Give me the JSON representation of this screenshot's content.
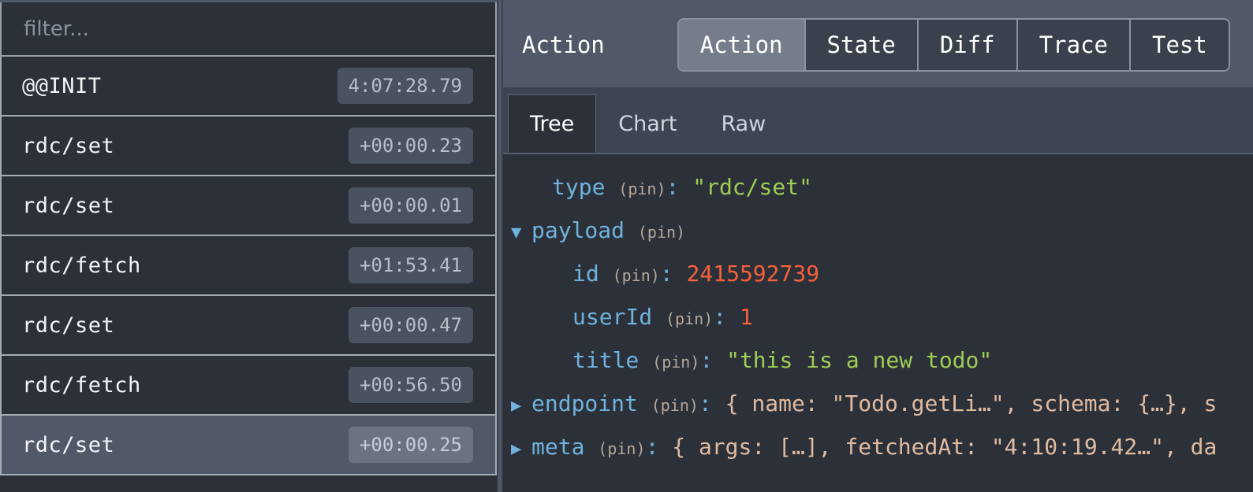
{
  "left_panel": {
    "filter": {
      "placeholder": "filter...",
      "value": ""
    },
    "actions": [
      {
        "name": "@@INIT",
        "time": "4:07:28.79",
        "selected": false
      },
      {
        "name": "rdc/set",
        "time": "+00:00.23",
        "selected": false
      },
      {
        "name": "rdc/set",
        "time": "+00:00.01",
        "selected": false
      },
      {
        "name": "rdc/fetch",
        "time": "+01:53.41",
        "selected": false
      },
      {
        "name": "rdc/set",
        "time": "+00:00.47",
        "selected": false
      },
      {
        "name": "rdc/fetch",
        "time": "+00:56.50",
        "selected": false
      },
      {
        "name": "rdc/set",
        "time": "+00:00.25",
        "selected": true
      }
    ]
  },
  "right_panel": {
    "title": "Action",
    "tabs": [
      {
        "label": "Action",
        "active": true
      },
      {
        "label": "State",
        "active": false
      },
      {
        "label": "Diff",
        "active": false
      },
      {
        "label": "Trace",
        "active": false
      },
      {
        "label": "Test",
        "active": false
      }
    ],
    "subtabs": [
      {
        "label": "Tree",
        "active": true
      },
      {
        "label": "Chart",
        "active": false
      },
      {
        "label": "Raw",
        "active": false
      }
    ],
    "tree": {
      "rows": [
        {
          "arrow": "",
          "indent": 1,
          "key": "type",
          "pin": "(pin)",
          "colon": ":",
          "value": "\"rdc/set\"",
          "value_kind": "string"
        },
        {
          "arrow": "▼",
          "indent": 0,
          "key": "payload",
          "pin": "(pin)",
          "colon": "",
          "value": "",
          "value_kind": "none"
        },
        {
          "arrow": "",
          "indent": 2,
          "key": "id",
          "pin": "(pin)",
          "colon": ":",
          "value": "2415592739",
          "value_kind": "number"
        },
        {
          "arrow": "",
          "indent": 2,
          "key": "userId",
          "pin": "(pin)",
          "colon": ":",
          "value": "1",
          "value_kind": "number"
        },
        {
          "arrow": "",
          "indent": 2,
          "key": "title",
          "pin": "(pin)",
          "colon": ":",
          "value": "\"this is a new todo\"",
          "value_kind": "string"
        },
        {
          "arrow": "▶",
          "indent": 0,
          "key": "endpoint",
          "pin": "(pin)",
          "colon": ":",
          "value": "{ name: \"Todo.getLi…\", schema: {…}, s",
          "value_kind": "preview"
        },
        {
          "arrow": "▶",
          "indent": 0,
          "key": "meta",
          "pin": "(pin)",
          "colon": ":",
          "value": "{ args: […], fetchedAt: \"4:10:19.42…\", da",
          "value_kind": "preview"
        }
      ]
    }
  },
  "colors": {
    "panel_bg": "#2b3039",
    "chrome_bg": "#515968",
    "right_bg": "#3e4451",
    "key_blue": "#6fb3dd",
    "string_green": "#9fce54",
    "number_orange": "#f5603a",
    "preview_tan": "#e0bba0",
    "pin_grey": "#b5a89a"
  }
}
